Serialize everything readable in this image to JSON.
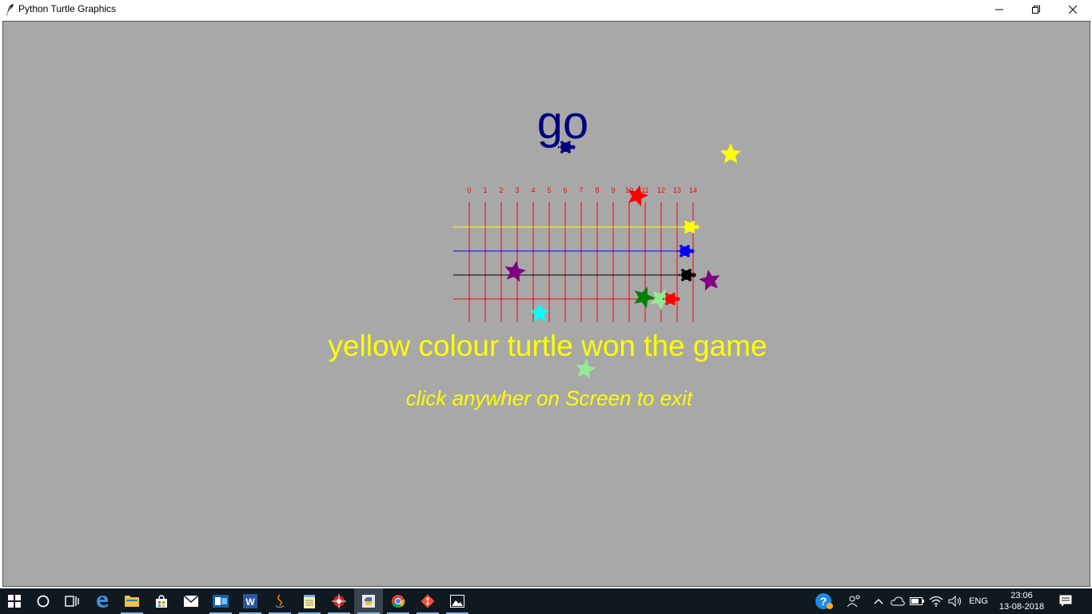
{
  "window": {
    "title": "Python Turtle Graphics",
    "icon": "feather-icon"
  },
  "canvas": {
    "background": "#a8a8a8",
    "go_text": "go",
    "go_color": "#000080",
    "winner_text": "yellow colour turtle won the game",
    "exit_text": "click anywher on Screen to exit",
    "message_color": "#ffff00",
    "finish_column": 14,
    "track": {
      "columns": [
        "0",
        "1",
        "2",
        "3",
        "4",
        "5",
        "6",
        "7",
        "8",
        "9",
        "10",
        "11",
        "12",
        "13",
        "14"
      ],
      "line_color": "#ff0000"
    },
    "turtles": [
      {
        "color": "#ffff00",
        "name": "yellow",
        "column": 13.8
      },
      {
        "color": "#0000ff",
        "name": "blue",
        "column": 13.5
      },
      {
        "color": "#000000",
        "name": "black",
        "column": 13.6
      },
      {
        "color": "#ff0000",
        "name": "red",
        "column": 12.6
      }
    ],
    "starter_turtle_color": "#000080",
    "stars": [
      {
        "color": "#ffff00"
      },
      {
        "color": "#ff0000"
      },
      {
        "color": "#800080"
      },
      {
        "color": "#800080"
      },
      {
        "color": "#008000"
      },
      {
        "color": "#90ee90"
      },
      {
        "color": "#00ffff"
      },
      {
        "color": "#90ee90"
      }
    ]
  },
  "taskbar": {
    "apps": [
      "windows-start-icon",
      "cortana-search-icon",
      "task-view-icon",
      "edge-icon",
      "file-explorer-icon",
      "store-icon",
      "mail-icon",
      "outlook-icon",
      "word-icon",
      "java-icon",
      "notepad-icon",
      "network-tool-icon",
      "python-icon",
      "chrome-icon",
      "git-icon",
      "photos-icon"
    ],
    "language": "ENG",
    "time": "23:06",
    "date": "13-08-2018"
  }
}
